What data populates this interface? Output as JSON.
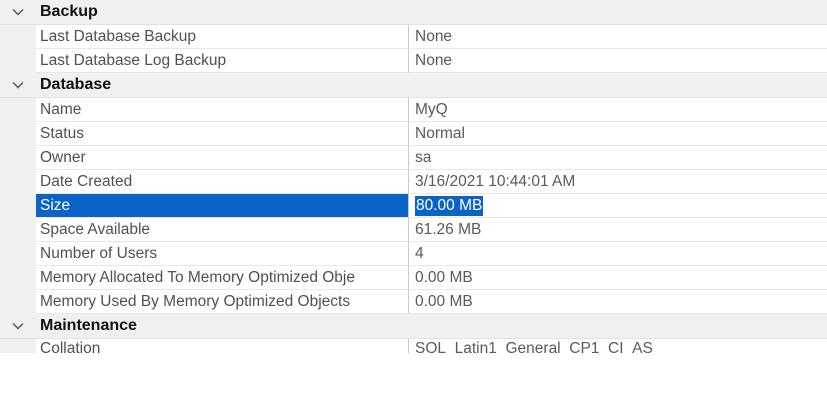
{
  "categories": [
    {
      "title": "Backup",
      "properties": [
        {
          "name": "Last Database Backup",
          "value": "None"
        },
        {
          "name": "Last Database Log Backup",
          "value": "None"
        }
      ]
    },
    {
      "title": "Database",
      "properties": [
        {
          "name": "Name",
          "value": "MyQ"
        },
        {
          "name": "Status",
          "value": "Normal"
        },
        {
          "name": "Owner",
          "value": "sa"
        },
        {
          "name": "Date Created",
          "value": "3/16/2021 10:44:01 AM"
        },
        {
          "name": "Size",
          "value": "80.00 MB",
          "selected": true
        },
        {
          "name": "Space Available",
          "value": "61.26 MB"
        },
        {
          "name": "Number of Users",
          "value": "4"
        },
        {
          "name": "Memory Allocated To Memory Optimized Obje",
          "value": "0.00 MB"
        },
        {
          "name": "Memory Used By Memory Optimized Objects",
          "value": "0.00 MB"
        }
      ]
    },
    {
      "title": "Maintenance",
      "properties": [
        {
          "name": "Collation",
          "value": "SQL_Latin1_General_CP1_CI_AS"
        }
      ]
    }
  ],
  "icons": {
    "expander": "chevron-down-icon"
  },
  "colors": {
    "selection": "#0a64c8",
    "category_background": "#f0f0f0"
  }
}
